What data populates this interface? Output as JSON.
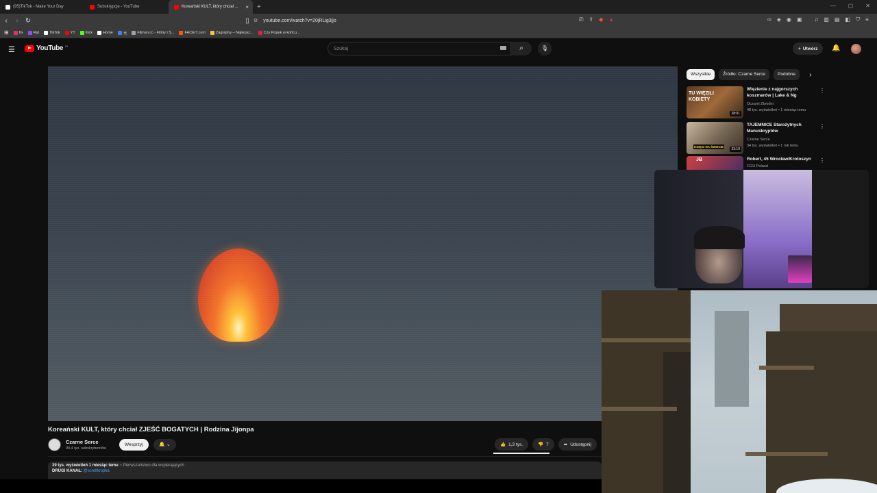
{
  "browser": {
    "tabs": [
      {
        "label": "(95)TikTok - Make Your Day",
        "icon": "tiktok-icon",
        "color": "#ffffff"
      },
      {
        "label": "Subskrypcje - YouTube",
        "icon": "youtube-icon",
        "color": "#ff0000"
      },
      {
        "label": "Koreański KULT, który chciał ...",
        "icon": "youtube-icon",
        "color": "#ff0000",
        "active": true
      }
    ],
    "url": "youtube.com/watch?v=20jRLig3jjo",
    "bookmarks": [
      {
        "label": "IG",
        "color": "#e1306c"
      },
      {
        "label": "Rat",
        "color": "#8a4fff"
      },
      {
        "label": "TikTok",
        "color": "#ffffff"
      },
      {
        "label": "YT",
        "color": "#ff0000"
      },
      {
        "label": "Kick",
        "color": "#53fc18"
      },
      {
        "label": "Home",
        "color": "#ffffff"
      },
      {
        "label": "元",
        "color": "#3b82f6"
      },
      {
        "label": "Filman.cc - Filmy i S...",
        "color": "#9ca3af"
      },
      {
        "label": "FACEIT.com",
        "color": "#ff5500"
      },
      {
        "label": "Zagrajmy – Najlepsz...",
        "color": "#f5c542"
      },
      {
        "label": "Czy Popek w końcu...",
        "color": "#e11d48"
      }
    ]
  },
  "youtube": {
    "logo": "YouTube",
    "region": "PL",
    "search_placeholder": "Szukaj",
    "create_label": "Utwórz"
  },
  "video": {
    "title": "Koreański KULT, który chciał ZJEŚĆ BOGATYCH | Rodzina Jijonpa",
    "channel": "Czarne Serce",
    "subscribers": "90,4 tys. subskrybentów",
    "support_label": "Wesprzyj",
    "likes": "1,3 tys.",
    "dislikes": "7",
    "share_label": "Udostępnij",
    "views": "39 tys. wyświetleń",
    "date": "1 miesiąc temu",
    "priority": "Pierwszeństwo dla wspierających",
    "desc_prefix": "DRUGI KANAŁ:",
    "desc_link": "@scrollkropka"
  },
  "sidebar": {
    "chips": [
      "Wszystkie",
      "Źródło: Czarne Serce",
      "Podobne"
    ],
    "recommendations": [
      {
        "title": "Więzienie z najgorszych koszmarów | Lake & Ng",
        "channel": "Oczami Zbrodni",
        "meta": "48 tys. wyświetleń • 1 miesiąc temu",
        "duration": "28:01",
        "thumb_text": "TU WIĘZILI KOBIETY"
      },
      {
        "title": "TAJEMNICE Starożytnych Manuskryptów",
        "channel": "Czarne Serce",
        "meta": "34 tys. wyświetleń • 1 rok temu",
        "duration": "33:19",
        "thumb_text": "KSIĘGI NA ŚWIECIE"
      },
      {
        "title": "Robert, 45 Wrocław/Krotoszyn",
        "channel": "CGU Poland",
        "meta": "",
        "duration": "",
        "thumb_text": "JB"
      }
    ]
  }
}
